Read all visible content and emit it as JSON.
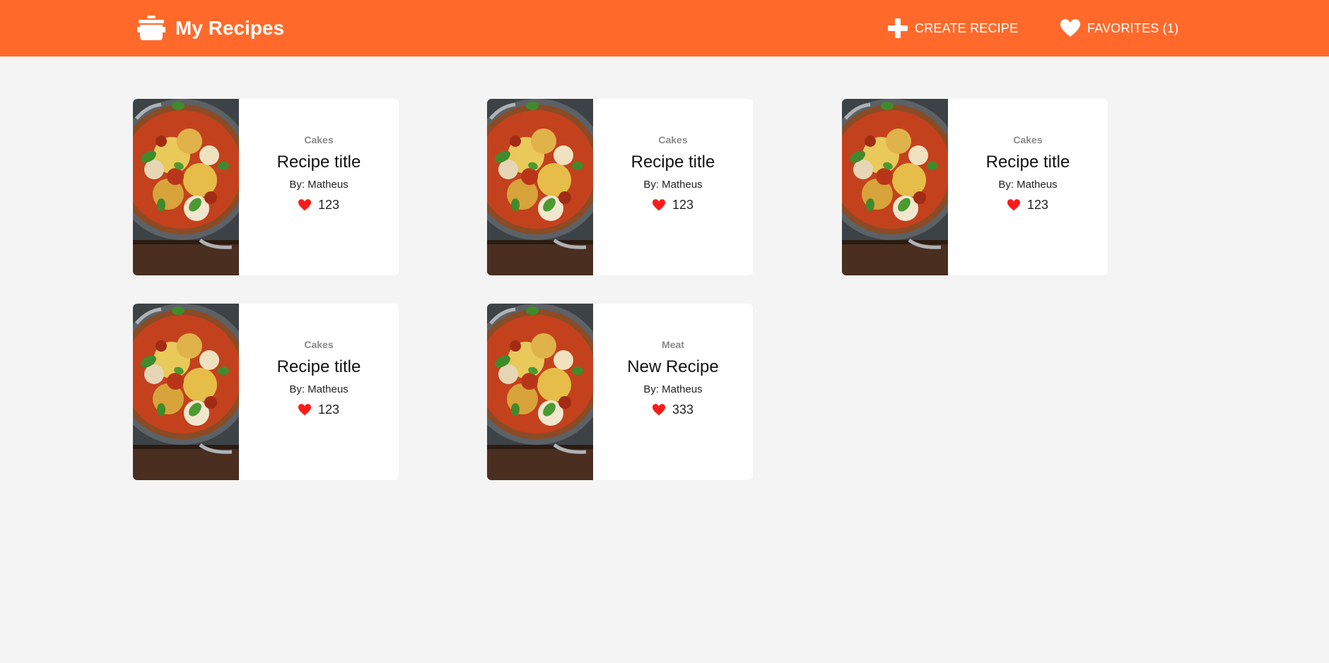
{
  "header": {
    "brand_icon": "cooking-pot-icon",
    "title": "My Recipes",
    "create_label": "CREATE RECIPE",
    "create_icon": "plus-icon",
    "favorites_label": "FAVORITES (1)",
    "favorites_icon": "heart-icon",
    "color": "#ff6a2b"
  },
  "recipes": [
    {
      "category": "Cakes",
      "title": "Recipe title",
      "author": "By: Matheus",
      "likes": "123"
    },
    {
      "category": "Cakes",
      "title": "Recipe title",
      "author": "By: Matheus",
      "likes": "123"
    },
    {
      "category": "Cakes",
      "title": "Recipe title",
      "author": "By: Matheus",
      "likes": "123"
    },
    {
      "category": "Cakes",
      "title": "Recipe title",
      "author": "By: Matheus",
      "likes": "123"
    },
    {
      "category": "Meat",
      "title": "New Recipe",
      "author": "By: Matheus",
      "likes": "333"
    }
  ],
  "like_icon": "heart-icon",
  "like_color": "#ff1a1a",
  "background": "#f4f4f4"
}
